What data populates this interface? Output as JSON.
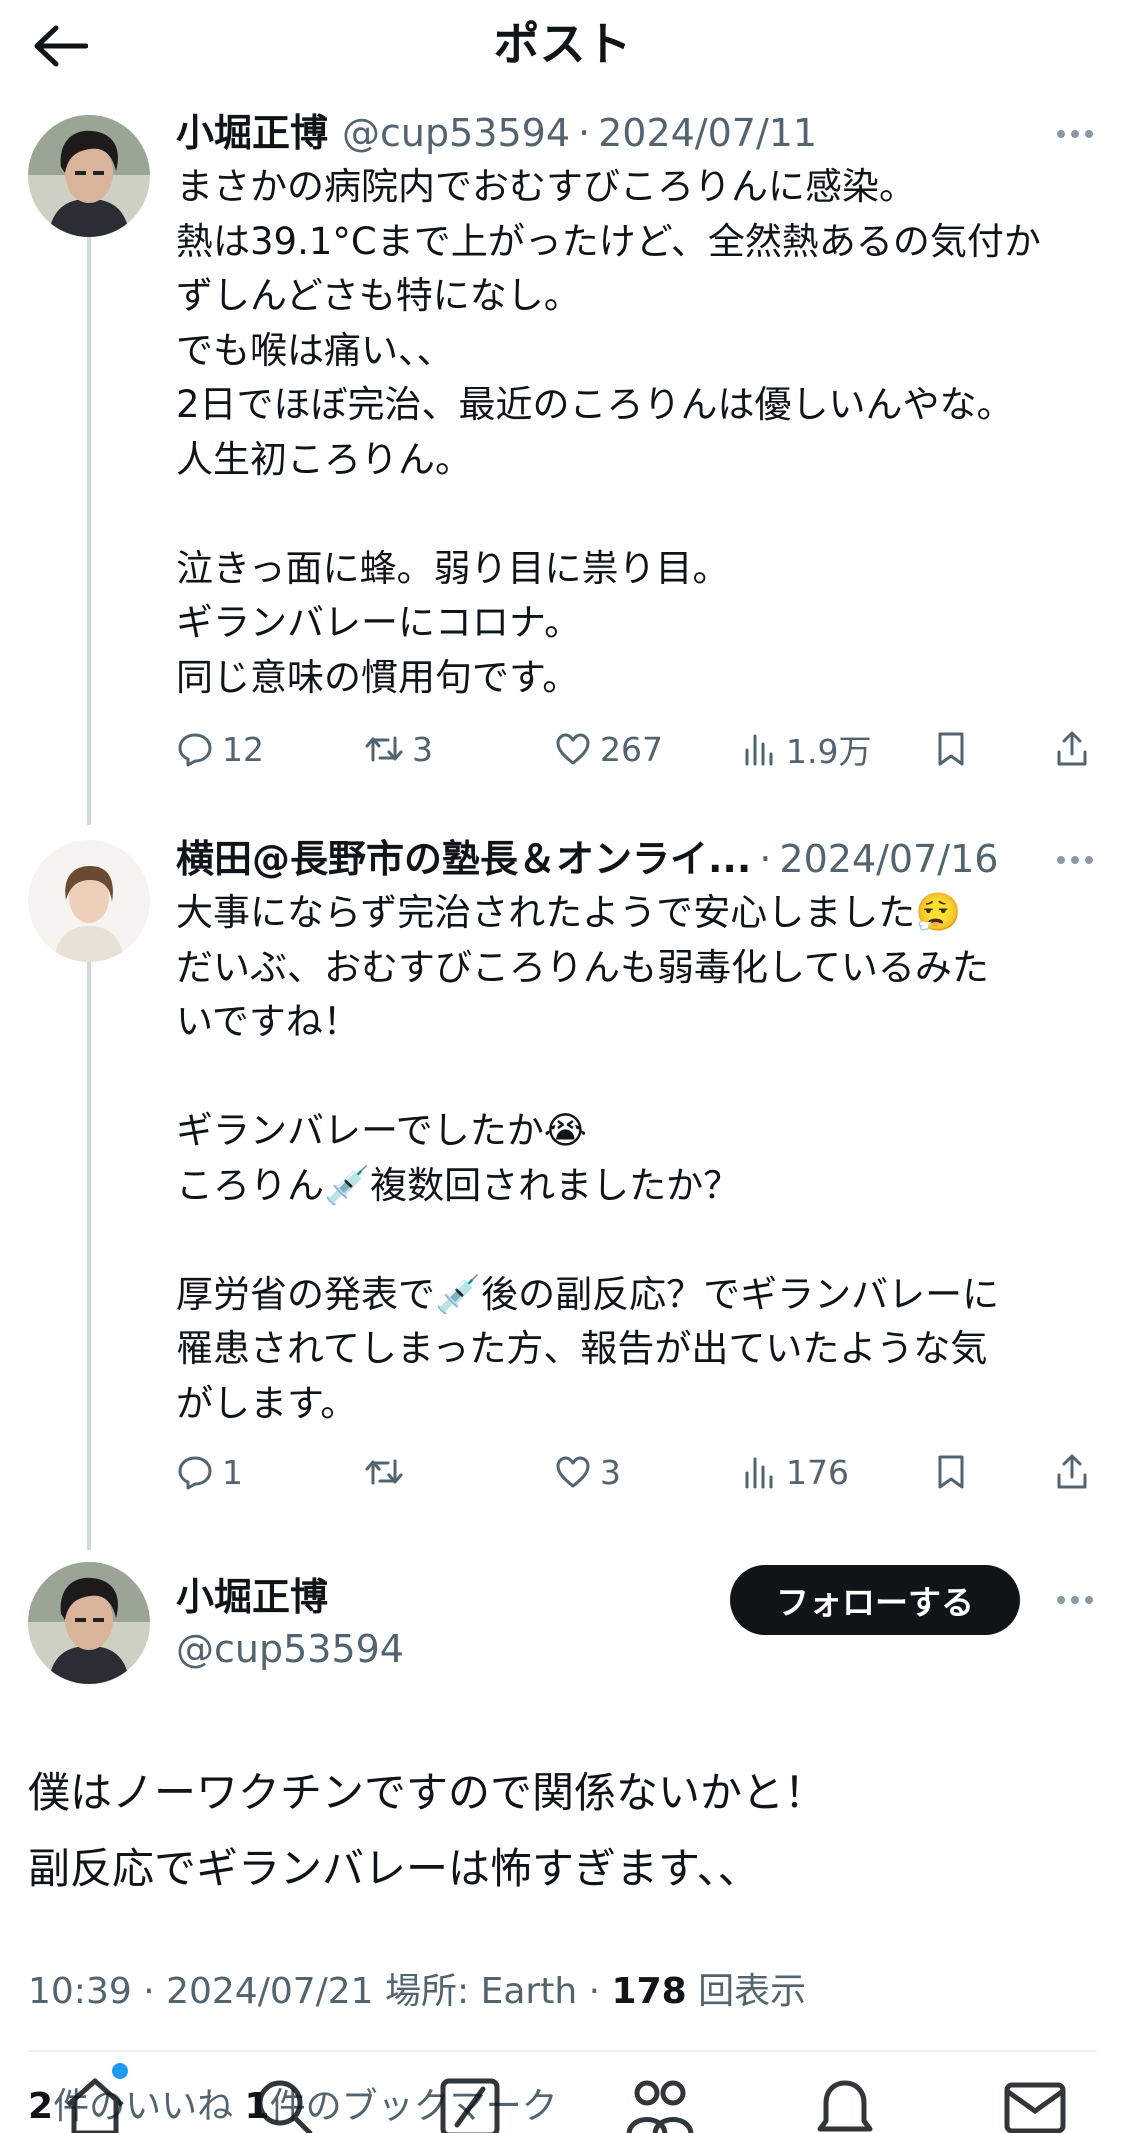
{
  "header": {
    "title": "ポスト"
  },
  "tweets": [
    {
      "name": "小堀正博",
      "handle": "@cup53594",
      "date": "2024/07/11",
      "lines": [
        "まさかの病院内でおむすびころりんに感染。",
        "熱は39.1°Cまで上がったけど、全然熱あるの気付か",
        "ずしんどさも特になし。",
        "でも喉は痛い、、",
        "2日でほぼ完治、最近のころりんは優しいんやな。",
        "人生初ころりん。",
        "",
        "泣きっ面に蜂。弱り目に祟り目。",
        "ギランバレーにコロナ。",
        "同じ意味の慣用句です。"
      ],
      "replies": "12",
      "reposts": "3",
      "likes": "267",
      "views": "1.9万"
    },
    {
      "name": "横田@長野市の塾長＆オンライ...",
      "handle": "",
      "date": "2024/07/16",
      "lines": [
        "大事にならず完治されたようで安心しました😮‍💨",
        "だいぶ、おむすびころりんも弱毒化しているみた",
        "いですね！",
        "",
        "ギランバレーでしたか😭",
        "ころりん💉複数回されましたか？",
        "",
        "厚労省の発表で💉後の副反応？でギランバレーに",
        "罹患されてしまった方、報告が出ていたような気",
        "がします。"
      ],
      "replies": "1",
      "reposts": "",
      "likes": "3",
      "views": "176"
    }
  ],
  "main": {
    "name": "小堀正博",
    "handle": "@cup53594",
    "follow_label": "フォローする",
    "lines": [
      "僕はノーワクチンですので関係ないかと！",
      "副反応でギランバレーは怖すぎます、、"
    ],
    "time": "10:39",
    "date": "2024/07/21",
    "location": "場所: Earth",
    "views_count": "178",
    "views_label": "回表示",
    "likes_count": "2",
    "likes_label": "件のいいね",
    "bookmarks_count": "1",
    "bookmarks_label": "件のブックマーク"
  },
  "icons": {
    "back": "arrow-left-icon",
    "more": "more-dots-icon",
    "reply": "reply-icon",
    "repost": "repost-icon",
    "like": "heart-icon",
    "views": "views-icon",
    "bookmark": "bookmark-icon",
    "share": "share-icon",
    "home": "home-icon",
    "search": "search-icon",
    "grok": "grok-icon",
    "communities": "people-icon",
    "notifications": "bell-icon",
    "messages": "mail-icon"
  },
  "colors": {
    "accent": "#1d9bf0",
    "text": "#0f1419",
    "muted": "#536471"
  }
}
